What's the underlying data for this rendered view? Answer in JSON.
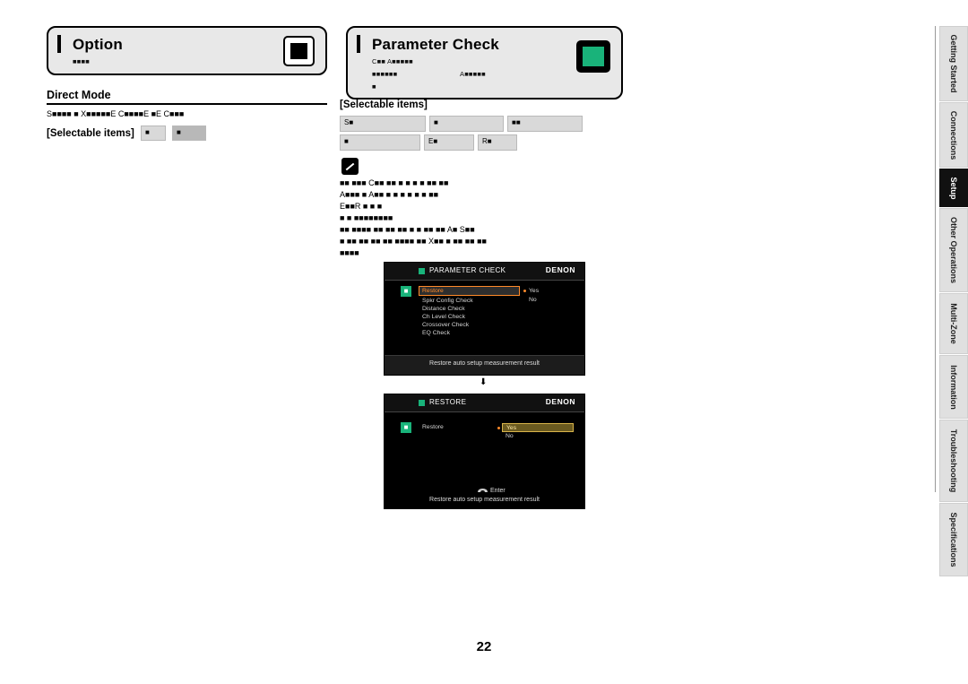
{
  "page": {
    "number": "22"
  },
  "left": {
    "panel": {
      "title": "Option",
      "subtitle": "■■■■"
    },
    "section": {
      "heading": "Direct Mode",
      "body_line1": "S■■■■            ■ X■■■■■E C■■■■E  ■E C■■■",
      "selectable_label": "[Selectable items]",
      "chip1": "■",
      "chip2": "■"
    }
  },
  "right": {
    "panel": {
      "title": "Parameter Check",
      "line1": "C■■      A■■■■■",
      "line2": "■■■■■■",
      "line2b": "A■■■■■",
      "line3": "■"
    },
    "selectable_label": "[Selectable items]",
    "chips": [
      {
        "text": "S■"
      },
      {
        "text": "■"
      },
      {
        "text": "■■"
      },
      {
        "text": "■"
      },
      {
        "text": "E■"
      },
      {
        "text": "R■"
      }
    ],
    "note_lines": [
      "■■   ■■■   C■■     ■■          ■       ■   ■  ■       ■■              ■■",
      "A■■■              ■   A■■          ■       ■   ■   ■          ■       ■      ■■",
      "E■■R     ■   ■ ■",
      "■     ■      ■■■■■■■■",
      "■■   ■■■■       ■■  ■■        ■■  ■ ■        ■■  ■■    A■    S■■",
      "■        ■■      ■■        ■■        ■■  ■■■■      ■■  X■■ ■  ■■     ■■ ■■",
      "■■■■"
    ]
  },
  "screens": [
    {
      "name": "parameter-check",
      "titlebar": "PARAMETER CHECK",
      "brand": "DENON",
      "badge": "■",
      "highlighted_item": "Restore",
      "items": [
        "Spkr Config Check",
        "Distance Check",
        "Ch Level Check",
        "Crossover Check",
        "EQ Check"
      ],
      "values": [
        "Yes",
        "No"
      ],
      "footer": "Restore auto setup measurement result"
    },
    {
      "name": "restore",
      "titlebar": "RESTORE",
      "brand": "DENON",
      "badge": "■",
      "label": "Restore",
      "selected_value": "Yes",
      "other_value": "No",
      "enter_label": "Enter",
      "footer": "Restore auto setup measurement result"
    }
  ],
  "arrow": "⬇",
  "side_tabs": [
    {
      "label": "Getting Started",
      "active": false
    },
    {
      "label": "Connections",
      "active": false
    },
    {
      "label": "Setup",
      "active": true
    },
    {
      "label": "Other Operations",
      "active": false
    },
    {
      "label": "Multi-Zone",
      "active": false
    },
    {
      "label": "Information",
      "active": false
    },
    {
      "label": "Troubleshooting",
      "active": false
    },
    {
      "label": "Specifications",
      "active": false
    }
  ]
}
